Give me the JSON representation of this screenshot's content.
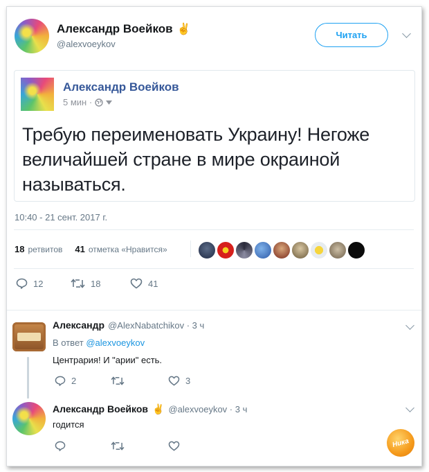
{
  "header": {
    "name": "Александр Воейков",
    "emoji": "✌",
    "handle": "@alexvoeykov",
    "follow_label": "Читать"
  },
  "quoted": {
    "name": "Александр Воейков",
    "meta": "5 мин ·",
    "text": "Требую переименовать Украину! Негоже величайшей стране в мире окраиной называться."
  },
  "timestamp": "10:40 - 21 сент. 2017 г.",
  "stats": {
    "retweets_count": "18",
    "retweets_label": "ретвитов",
    "likes_count": "41",
    "likes_label": "отметка «Нравится»"
  },
  "actions": {
    "replies": "12",
    "retweets": "18",
    "likes": "41"
  },
  "replies": [
    {
      "name": "Александр",
      "handle": "@AlexNabatchikov · 3 ч",
      "in_reply_prefix": "В ответ",
      "in_reply_handle": "@alexvoeykov",
      "text": "Центрария! И \"арии\" есть.",
      "reply_count": "2",
      "like_count": "3"
    },
    {
      "name": "Александр Воейков",
      "emoji": "✌",
      "handle": "@alexvoeykov · 3 ч",
      "text": "годится"
    }
  ],
  "watermark": "Ника",
  "colors": {
    "accent": "#1da1f2",
    "facebook_name": "#365899",
    "muted": "#657786"
  }
}
